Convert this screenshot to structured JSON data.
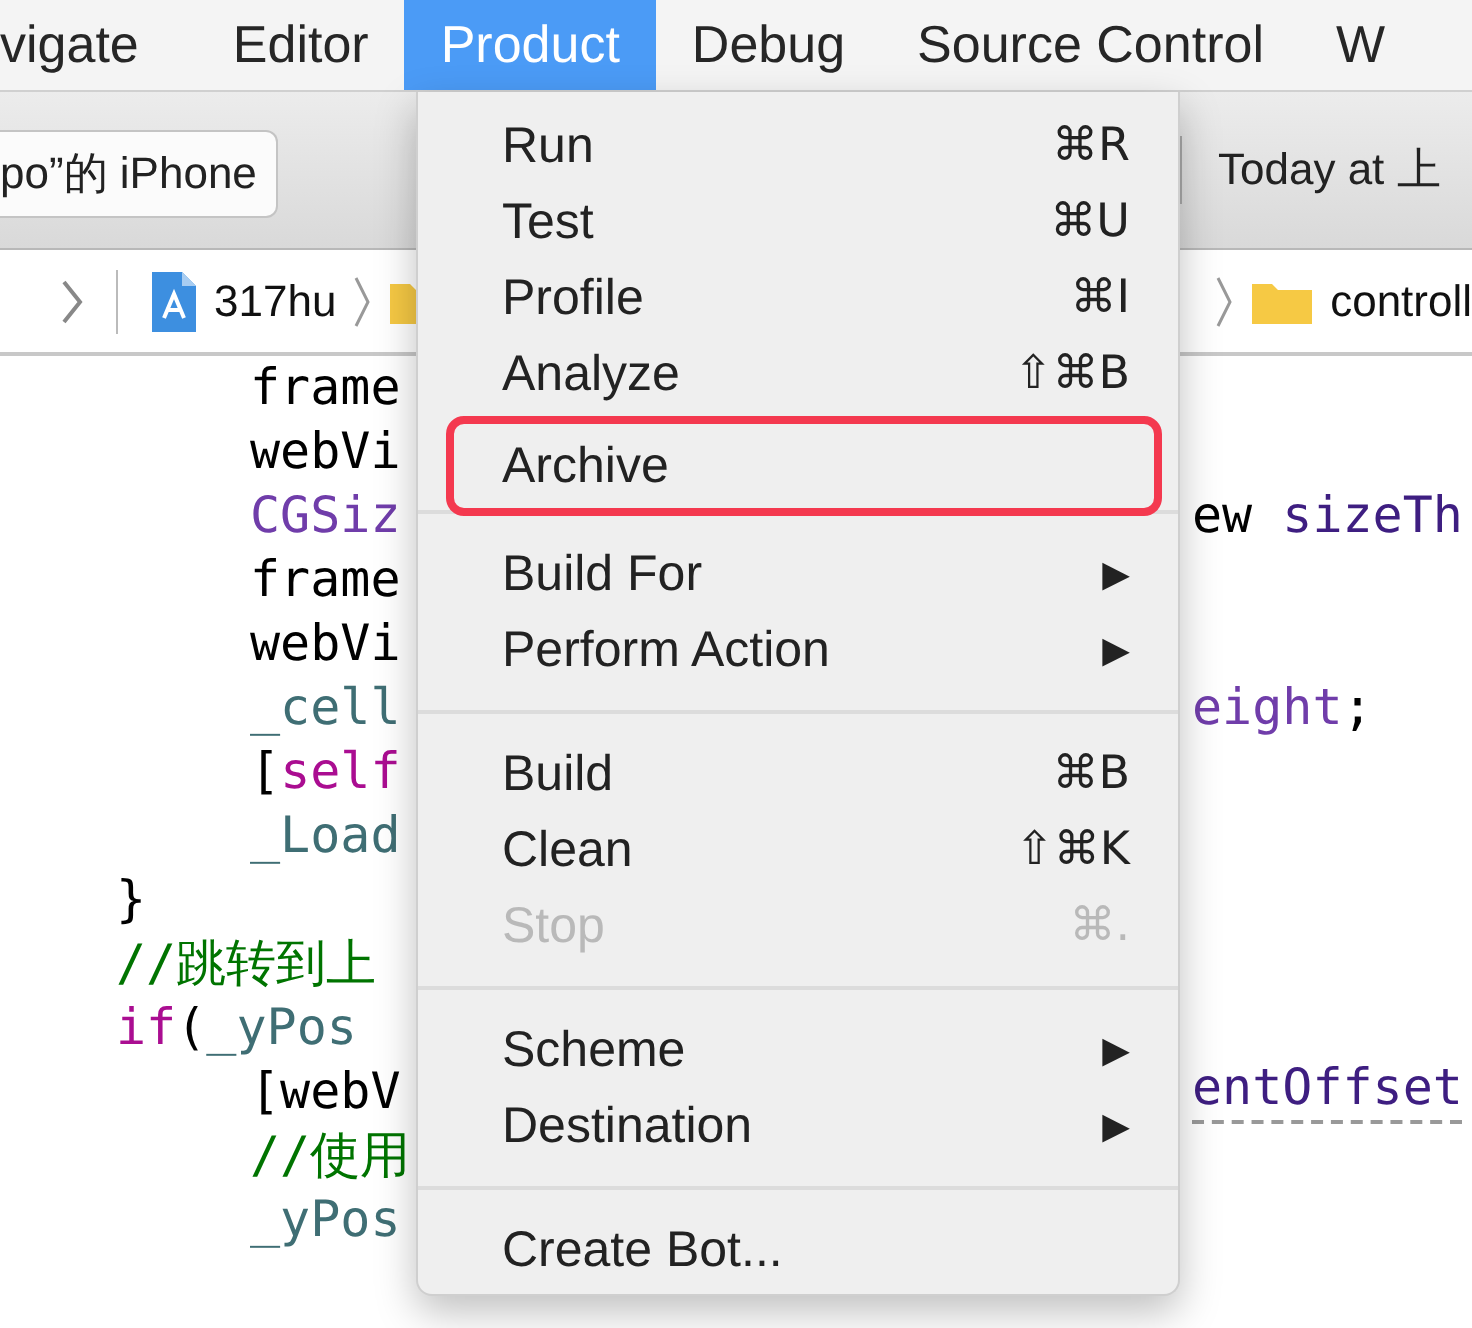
{
  "menubar": [
    {
      "label": "vigate",
      "selected": false
    },
    {
      "label": "Editor",
      "selected": false
    },
    {
      "label": "Product",
      "selected": true
    },
    {
      "label": "Debug",
      "selected": false
    },
    {
      "label": "Source Control",
      "selected": false
    },
    {
      "label": "W",
      "selected": false
    }
  ],
  "toolbar": {
    "device": "po”的 iPhone",
    "status": "Today at 上"
  },
  "breadcrumb": {
    "left": "317hu",
    "right": "controll"
  },
  "code_lines": [
    {
      "kind": "inner",
      "left": [
        {
          "text": "frame",
          "kind": "plain"
        }
      ]
    },
    {
      "kind": "inner",
      "left": [
        {
          "text": "webVi",
          "kind": "plain"
        }
      ]
    },
    {
      "kind": "inner",
      "left": [
        {
          "text": "CGSiz",
          "kind": "type"
        }
      ],
      "right": [
        {
          "text": "ew ",
          "kind": "plain"
        },
        {
          "text": "sizeTh",
          "kind": "method"
        }
      ]
    },
    {
      "kind": "inner",
      "left": [
        {
          "text": "frame",
          "kind": "plain"
        }
      ]
    },
    {
      "kind": "inner",
      "left": [
        {
          "text": "webVi",
          "kind": "plain"
        }
      ]
    },
    {
      "kind": "inner",
      "left": [
        {
          "text": "_cell",
          "kind": "ivar"
        }
      ],
      "right": [
        {
          "text": "eight",
          "kind": "type"
        },
        {
          "text": ";",
          "kind": "plain"
        }
      ]
    },
    {
      "kind": "inner",
      "left": [
        {
          "text": "[",
          "kind": "plain"
        },
        {
          "text": "self",
          "kind": "keyword"
        }
      ]
    },
    {
      "kind": "inner",
      "left": [
        {
          "text": "_Load",
          "kind": "ivar"
        }
      ]
    },
    {
      "kind": "outer",
      "left": [
        {
          "text": "}",
          "kind": "plain"
        }
      ]
    },
    {
      "kind": "outer",
      "left": [
        {
          "text": "//跳转到上",
          "kind": "comment"
        }
      ]
    },
    {
      "kind": "outer",
      "left": [
        {
          "text": "if",
          "kind": "keyword"
        },
        {
          "text": "(",
          "kind": "plain"
        },
        {
          "text": "_yPos",
          "kind": "ivar"
        }
      ]
    },
    {
      "kind": "inner",
      "left": [
        {
          "text": "[webV",
          "kind": "plain"
        }
      ],
      "right": [
        {
          "text": "entOffset",
          "kind": "placeholder"
        }
      ]
    },
    {
      "kind": "inner",
      "left": [
        {
          "text": "//使用",
          "kind": "comment"
        }
      ]
    },
    {
      "kind": "inner",
      "left": [
        {
          "text": "_yPos",
          "kind": "ivar"
        }
      ]
    }
  ],
  "menu": {
    "items": [
      {
        "kind": "command",
        "label": "Run",
        "shortcut": "⌘R",
        "disabled": false,
        "highlighted": false
      },
      {
        "kind": "command",
        "label": "Test",
        "shortcut": "⌘U",
        "disabled": false,
        "highlighted": false
      },
      {
        "kind": "command",
        "label": "Profile",
        "shortcut": "⌘I",
        "disabled": false,
        "highlighted": false
      },
      {
        "kind": "command",
        "label": "Analyze",
        "shortcut": "⇧⌘B",
        "disabled": false,
        "highlighted": false
      },
      {
        "kind": "command",
        "label": "Archive",
        "disabled": false,
        "highlighted": true
      },
      {
        "kind": "separator"
      },
      {
        "kind": "submenu",
        "label": "Build For",
        "arrow": "▶",
        "disabled": false,
        "highlighted": false
      },
      {
        "kind": "submenu",
        "label": "Perform Action",
        "arrow": "▶",
        "disabled": false,
        "highlighted": false
      },
      {
        "kind": "separator"
      },
      {
        "kind": "command",
        "label": "Build",
        "shortcut": "⌘B",
        "disabled": false,
        "highlighted": false
      },
      {
        "kind": "command",
        "label": "Clean",
        "shortcut": "⇧⌘K",
        "disabled": false,
        "highlighted": false
      },
      {
        "kind": "command",
        "label": "Stop",
        "shortcut": "⌘.",
        "disabled": true,
        "highlighted": false
      },
      {
        "kind": "separator"
      },
      {
        "kind": "submenu",
        "label": "Scheme",
        "arrow": "▶",
        "disabled": false,
        "highlighted": false
      },
      {
        "kind": "submenu",
        "label": "Destination",
        "arrow": "▶",
        "disabled": false,
        "highlighted": false
      },
      {
        "kind": "separator"
      },
      {
        "kind": "command",
        "label": "Create Bot...",
        "disabled": false,
        "highlighted": false
      }
    ]
  }
}
